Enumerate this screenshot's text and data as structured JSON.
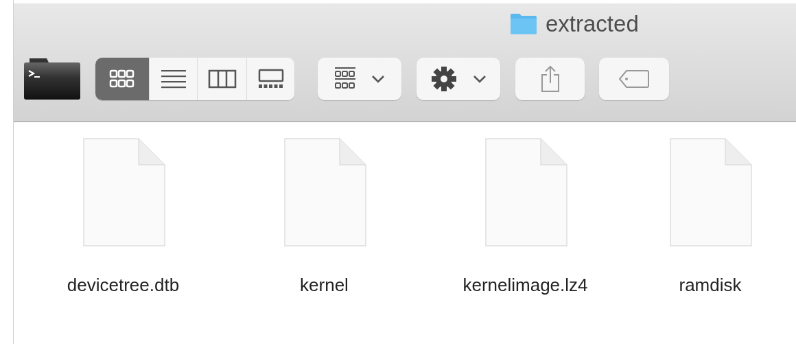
{
  "window": {
    "title": "extracted"
  },
  "view_modes": [
    {
      "kind": "icons",
      "selected": true
    },
    {
      "kind": "list",
      "selected": false
    },
    {
      "kind": "columns",
      "selected": false
    },
    {
      "kind": "gallery",
      "selected": false
    }
  ],
  "toolbar_buttons": [
    {
      "kind": "arrange"
    },
    {
      "kind": "action"
    },
    {
      "kind": "share"
    },
    {
      "kind": "tag"
    }
  ],
  "files": [
    {
      "name": "devicetree.dtb"
    },
    {
      "name": "kernel"
    },
    {
      "name": "kernelimage.lz4"
    },
    {
      "name": "ramdisk"
    }
  ]
}
